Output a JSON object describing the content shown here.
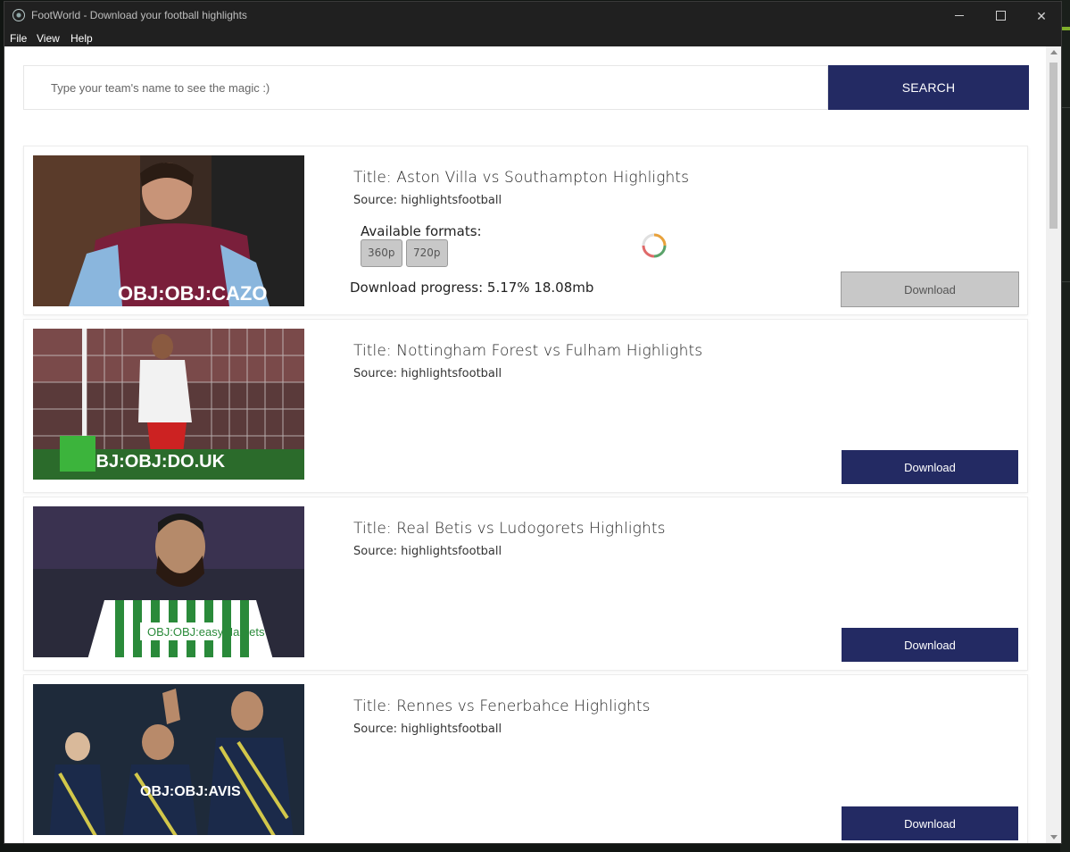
{
  "window": {
    "title": "FootWorld - Download your football highlights",
    "controls": {
      "minimize": "minimize",
      "maximize": "maximize",
      "close": "✕"
    }
  },
  "menu": [
    "File",
    "View",
    "Help"
  ],
  "search": {
    "placeholder": "Type your team's name to see the magic :)",
    "value": "",
    "button_label": "SEARCH"
  },
  "results": [
    {
      "title": "Title: Aston Villa vs Southampton Highlights",
      "source": "Source: highlightsfootball",
      "formats_label": "Available formats:",
      "formats": [
        "360p",
        "720p"
      ],
      "progress_text": "Download progress: 5.17% 18.08mb",
      "progress_percent": 5.17,
      "download_label": "Download",
      "downloading": true
    },
    {
      "title": "Title: Nottingham Forest vs Fulham Highlights",
      "source": "Source: highlightsfootball",
      "download_label": "Download",
      "downloading": false
    },
    {
      "title": "Title: Real Betis vs Ludogorets Highlights",
      "source": "Source: highlightsfootball",
      "download_label": "Download",
      "downloading": false
    },
    {
      "title": "Title: Rennes vs Fenerbahce Highlights",
      "source": "Source: highlightsfootball",
      "download_label": "Download",
      "downloading": false
    }
  ],
  "images": {
    "card1": "OBJ:OBJ:CAZO",
    "card2": "OBJ:OBJ:DO.UK",
    "card3": "OBJ:OBJ:easyMarkets",
    "card4": "OBJ:OBJ:AVIS"
  },
  "colors": {
    "accent": "#232a63",
    "disabled": "#c8c8c8",
    "titlebar": "#202020"
  }
}
